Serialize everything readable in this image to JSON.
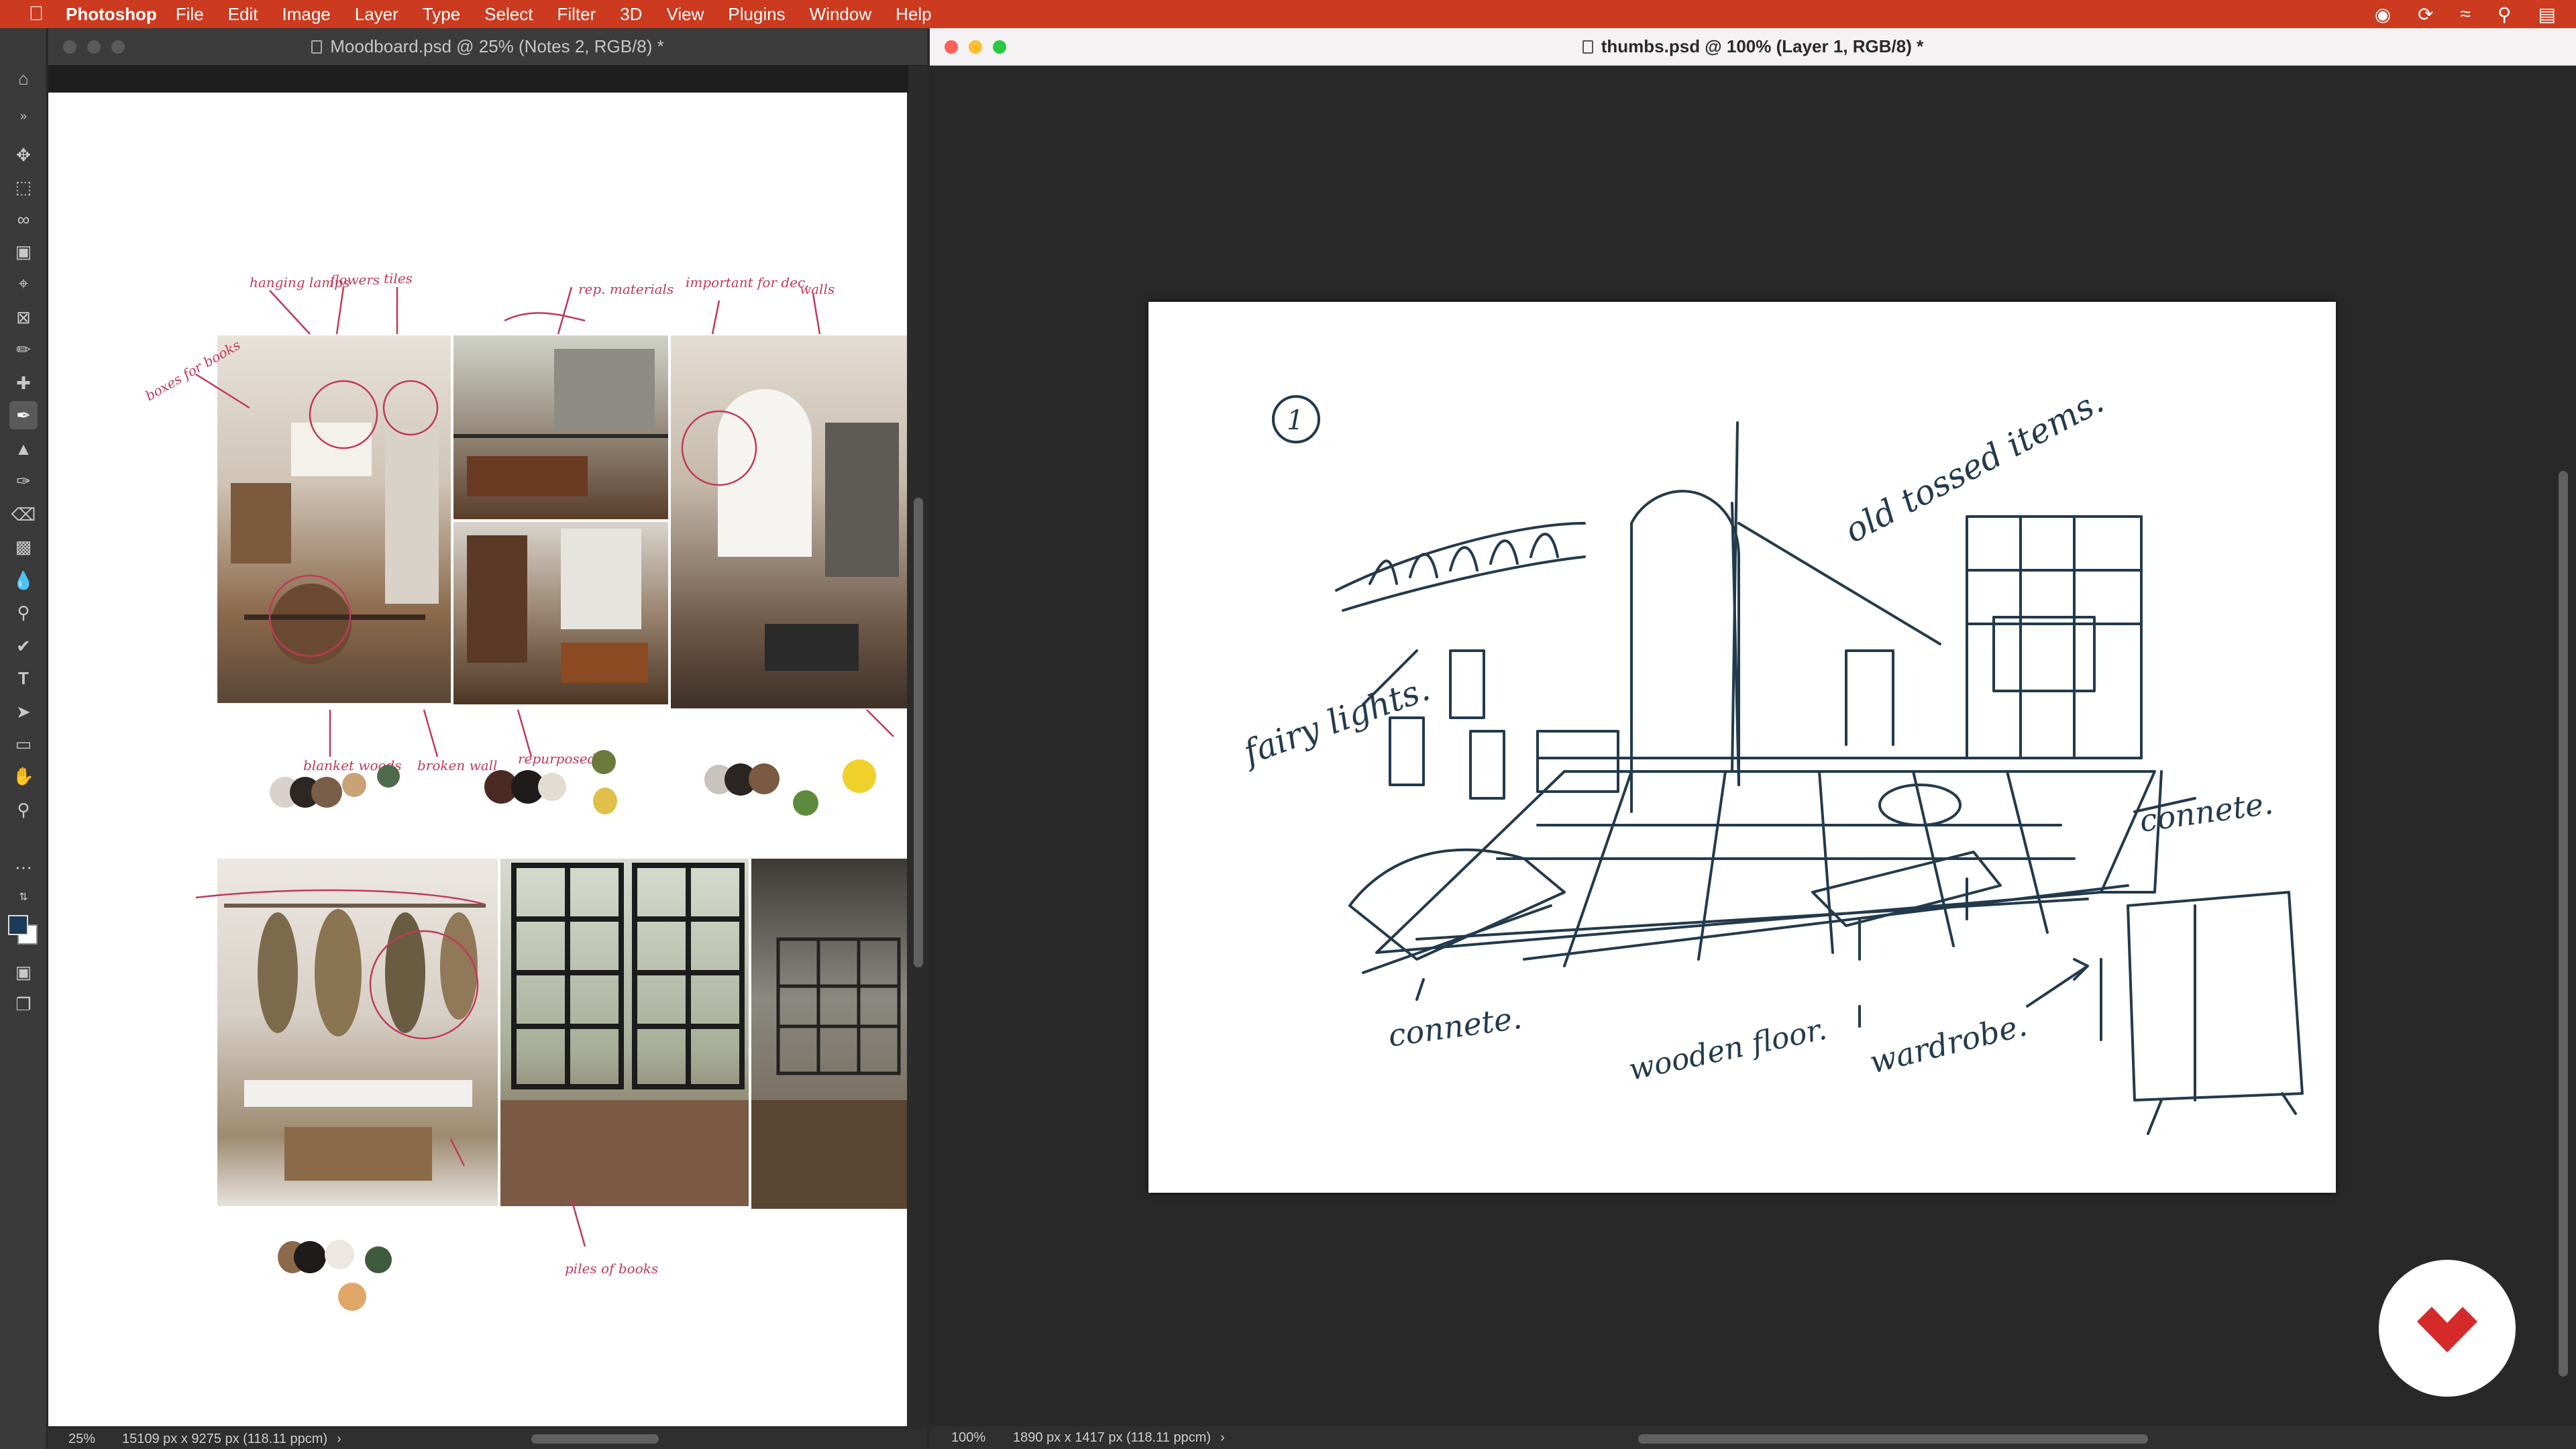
{
  "menubar": {
    "app_name": "Photoshop",
    "items": [
      "File",
      "Edit",
      "Image",
      "Layer",
      "Type",
      "Select",
      "Filter",
      "3D",
      "View",
      "Plugins",
      "Window",
      "Help"
    ],
    "status_icons": [
      "creative-cloud-icon",
      "sync-icon",
      "wifi-icon",
      "spotlight-search-icon",
      "control-center-icon"
    ]
  },
  "left_window": {
    "title": "Moodboard.psd @ 25% (Notes 2, RGB/8) *",
    "zoom": "25%",
    "doc_info": "15109 px x 9275 px (118.11 ppcm)",
    "palette_colors": {
      "row1_a": [
        "#d9d2cc",
        "#2e2622",
        "#7a5f48",
        "#c9a276",
        "#4f6b4a"
      ],
      "row1_b": [
        "#4a2a22",
        "#1f1b1a",
        "#e3dcd3",
        "#6b7a3b",
        "#e0c04a"
      ],
      "row1_c": [
        "#c9c3bd",
        "#2b2523",
        "#7a5a42",
        "#5d8a3c",
        "#f0d02a"
      ],
      "row2": [
        "#8a6a4a",
        "#1e1b1a",
        "#ece7e0",
        "#3f5a3c",
        "#e0a868"
      ]
    }
  },
  "right_window": {
    "title": "thumbs.psd @ 100% (Layer 1, RGB/8) *",
    "zoom": "100%",
    "doc_info": "1890 px x 1417 px (118.11 ppcm)"
  },
  "sketch": {
    "number": "1",
    "notes": [
      "old tossed items.",
      "fairy lights.",
      "connete.",
      "connete.",
      "wooden floor.",
      "wardrobe."
    ],
    "ink_color": "#233a4c"
  },
  "colors": {
    "menubar": "#cc3a1f",
    "annotation": "#c0395a"
  }
}
